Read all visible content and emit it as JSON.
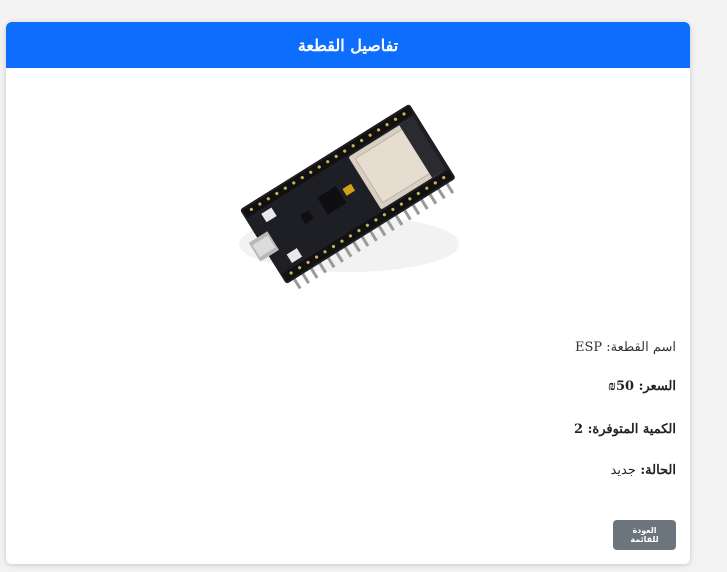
{
  "header": {
    "title": "تفاصيل القطعة"
  },
  "product": {
    "image_icon": "esp32-board-image",
    "name_label": "اسم القطعة:",
    "name_value": "ESP",
    "price_label": "السعر:",
    "price_value": "50₪",
    "qty_label": "الكمية المتوفرة:",
    "qty_value": "2",
    "condition_label": "الحالة:",
    "condition_value": "جديد"
  },
  "actions": {
    "back_label": "العودة للقائمة"
  },
  "colors": {
    "header_bg": "#0d6efd",
    "button_bg": "#6c757d"
  }
}
